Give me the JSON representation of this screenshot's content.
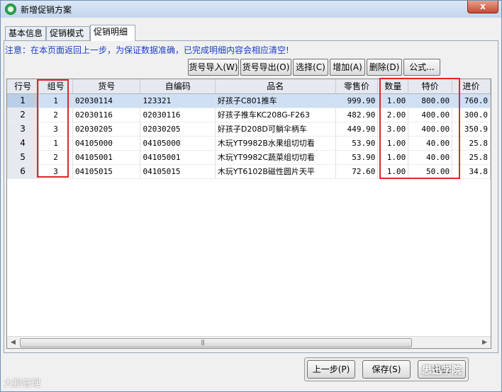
{
  "window": {
    "title": "新增促销方案",
    "close_glyph": "x"
  },
  "tabs": [
    {
      "label": "基本信息"
    },
    {
      "label": "促销模式"
    },
    {
      "label": "促销明细"
    }
  ],
  "notice": "注意：在本页面返回上一步，为保证数据准确，已完成明细内容会相应清空!",
  "toolbar": {
    "import": "货号导入(W)",
    "export": "货号导出(O)",
    "select": "选择(C)",
    "add": "增加(A)",
    "delete": "删除(D)",
    "formula": "公式..."
  },
  "grid": {
    "columns": [
      "行号",
      "组号",
      "货号",
      "自编码",
      "品名",
      "零售价",
      "数量",
      "特价",
      "进价"
    ],
    "rows": [
      [
        "1",
        "1",
        "02030114",
        "123321",
        "好孩子C801推车",
        "999.90",
        "1.00",
        "800.00",
        "760.0"
      ],
      [
        "2",
        "2",
        "02030116",
        "02030116",
        "好孩子推车KC208G-F263",
        "482.90",
        "2.00",
        "400.00",
        "300.0"
      ],
      [
        "3",
        "3",
        "02030205",
        "02030205",
        "好孩子D208D可躺伞柄车",
        "449.90",
        "3.00",
        "400.00",
        "350.9"
      ],
      [
        "4",
        "1",
        "04105000",
        "04105000",
        "木玩YT9982B水果组切切看",
        "53.90",
        "1.00",
        "40.00",
        "25.8"
      ],
      [
        "5",
        "2",
        "04105001",
        "04105001",
        "木玩YT9982C蔬菜组切切看",
        "53.90",
        "1.00",
        "40.00",
        "25.8"
      ],
      [
        "6",
        "3",
        "04105015",
        "04105015",
        "木玩YT6102B磁性圆片天平",
        "72.60",
        "1.00",
        "50.00",
        "34.8"
      ]
    ],
    "selected_row": 1
  },
  "scrollbar": {
    "left_glyph": "◀",
    "right_glyph": "▶",
    "grip_glyph": "|||"
  },
  "bottom": {
    "prev": "上一步(P)",
    "save": "保存(S)",
    "exit": "退出"
  },
  "watermarks": {
    "left": "大鹏管理",
    "right": "思迅学院"
  },
  "colors": {
    "highlight": "#e0262b",
    "notice": "#1a3fc7",
    "selected_row": "#cfe0f5"
  }
}
